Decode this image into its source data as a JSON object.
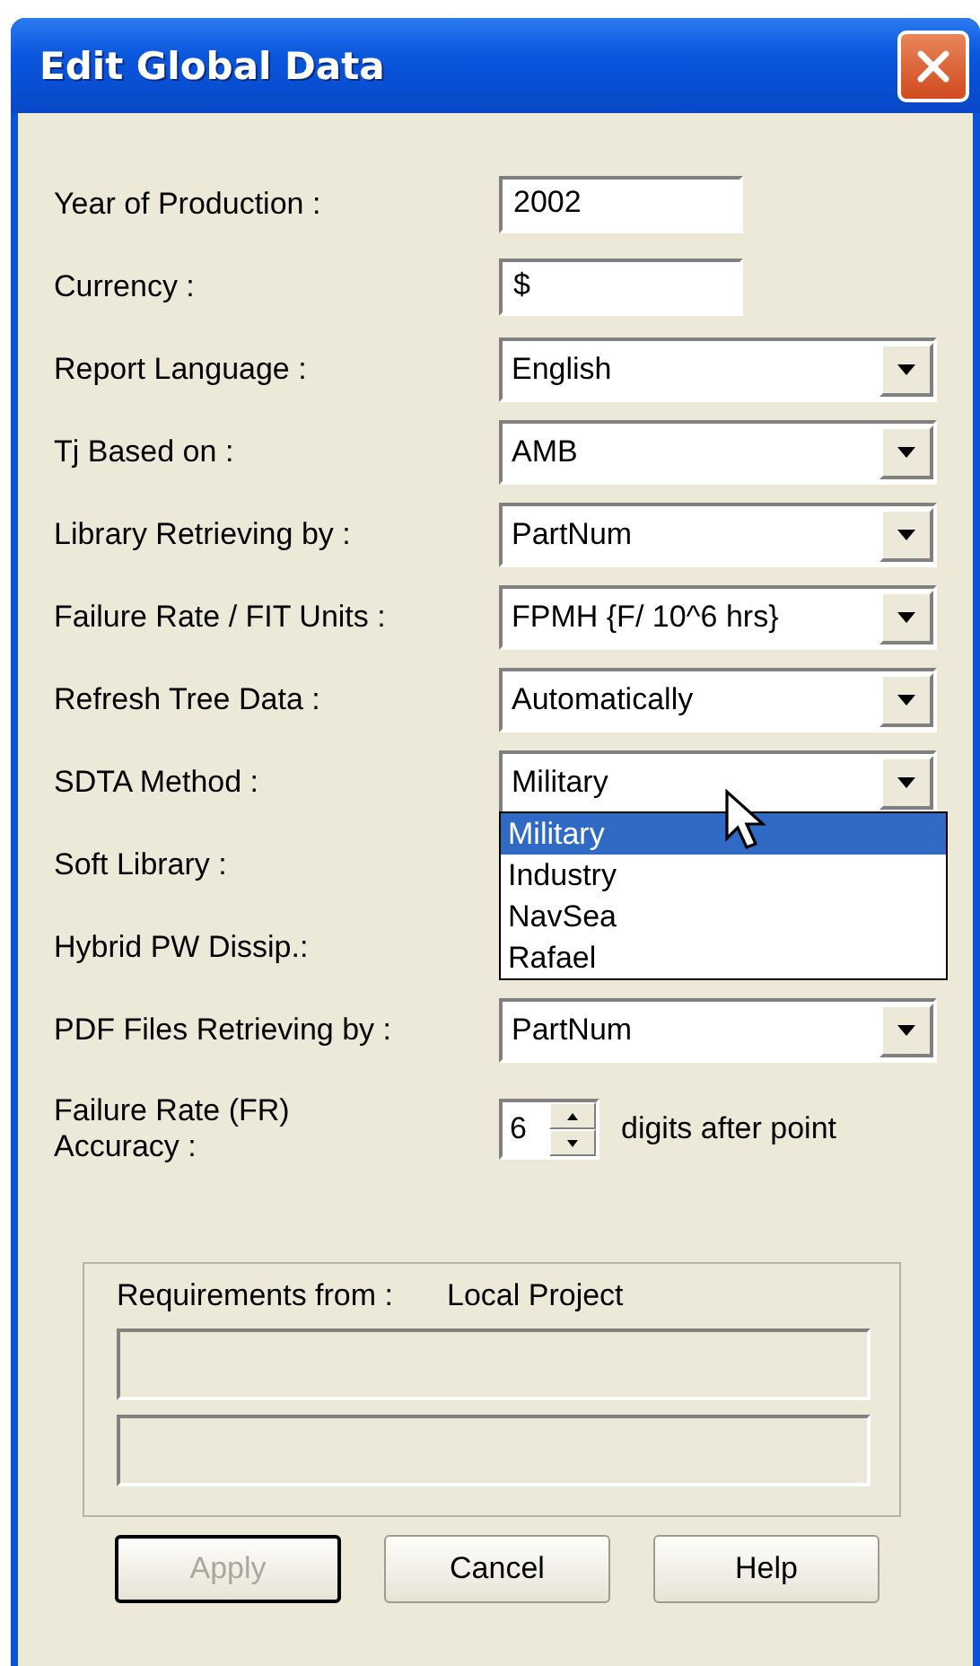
{
  "window": {
    "title": "Edit Global Data"
  },
  "fields": [
    {
      "kind": "text",
      "label": "Year of Production :",
      "value": "2002"
    },
    {
      "kind": "text",
      "label": "Currency :",
      "value": "$"
    },
    {
      "kind": "combo",
      "label": "Report Language :",
      "value": "English"
    },
    {
      "kind": "combo",
      "label": "Tj Based on :",
      "value": "AMB"
    },
    {
      "kind": "combo",
      "label": "Library Retrieving by :",
      "value": "PartNum"
    },
    {
      "kind": "combo",
      "label": "Failure Rate / FIT Units :",
      "value": "FPMH {F/ 10^6 hrs}"
    },
    {
      "kind": "combo",
      "label": "Refresh Tree Data :",
      "value": "Automatically"
    },
    {
      "kind": "combo",
      "label": "SDTA Method :",
      "value": "Military",
      "options": [
        {
          "label": "Military",
          "selected": true
        },
        {
          "label": "Industry",
          "selected": false
        },
        {
          "label": "NavSea",
          "selected": false
        },
        {
          "label": "Rafael",
          "selected": false
        }
      ]
    },
    {
      "kind": "covered",
      "label": "Soft Library :"
    },
    {
      "kind": "covered",
      "label": "Hybrid PW Dissip.:"
    },
    {
      "kind": "combo",
      "label": "PDF Files Retrieving by :",
      "value": "PartNum"
    },
    {
      "kind": "spinner",
      "label": "Failure Rate (FR) Accuracy :",
      "value": "6",
      "suffix": "digits after point"
    }
  ],
  "requirements": {
    "label": "Requirements from :",
    "source": "Local Project"
  },
  "buttons": [
    {
      "label": "Apply",
      "disabled": true,
      "default": true
    },
    {
      "label": "Cancel",
      "disabled": false,
      "default": false
    },
    {
      "label": "Help",
      "disabled": false,
      "default": false
    }
  ]
}
